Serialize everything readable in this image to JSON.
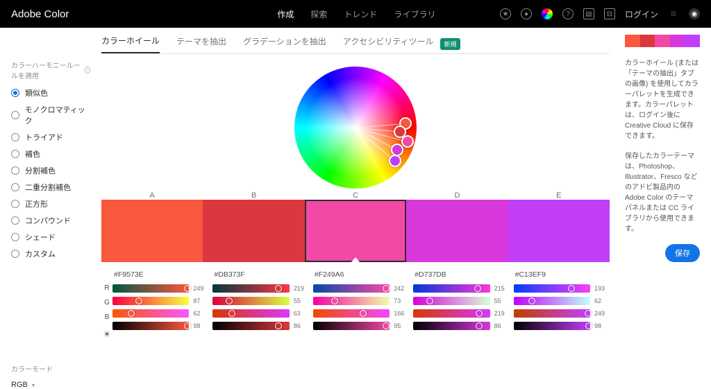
{
  "header": {
    "logo": "Adobe Color",
    "tabs": [
      "作成",
      "探索",
      "トレンド",
      "ライブラリ"
    ],
    "active_tab": 0,
    "login": "ログイン"
  },
  "subtabs": {
    "items": [
      "カラーホイール",
      "テーマを抽出",
      "グラデーションを抽出",
      "アクセシビリティツール"
    ],
    "active": 0,
    "badge": "新規"
  },
  "harmony": {
    "section_label": "カラーハーモニールールを適用",
    "rules": [
      "類似色",
      "モノクロマティック",
      "トライアド",
      "補色",
      "分割補色",
      "二重分割補色",
      "正方形",
      "コンパウンド",
      "シェード",
      "カスタム"
    ],
    "selected": 0
  },
  "color_mode": {
    "label": "カラーモード",
    "value": "RGB"
  },
  "swatches": {
    "labels": [
      "A",
      "B",
      "C",
      "D",
      "E"
    ],
    "selected": 2,
    "colors": [
      {
        "hex": "#F9573E",
        "r": 249,
        "g": 87,
        "b": 62,
        "brightness": 98
      },
      {
        "hex": "#DB373F",
        "r": 219,
        "g": 55,
        "b": 63,
        "brightness": 86
      },
      {
        "hex": "#F249A6",
        "r": 242,
        "g": 73,
        "b": 166,
        "brightness": 95
      },
      {
        "hex": "#D737DB",
        "r": 215,
        "g": 55,
        "b": 219,
        "brightness": 86
      },
      {
        "hex": "#C13EF9",
        "r": 193,
        "g": 62,
        "b": 249,
        "brightness": 98
      }
    ]
  },
  "channels": [
    "R",
    "G",
    "B"
  ],
  "right": {
    "desc1": "カラーホイール (または「テーマの抽出」タブの画像) を使用してカラーパレットを生成できます。カラーパレットは、ログイン後に Creative Cloud に保存できます。",
    "desc2": "保存したカラーテーマは、Photoshop、Illustrator、Fresco などのアドビ製品内の Adobe Color のテーマパネルまたは CC ライブラリから使用できます。",
    "save": "保存"
  },
  "wheel_dots": [
    {
      "angle": -5,
      "radius": 72
    },
    {
      "angle": 5,
      "radius": 64
    },
    {
      "angle": 15,
      "radius": 78
    },
    {
      "angle": 28,
      "radius": 68
    },
    {
      "angle": 40,
      "radius": 74
    }
  ]
}
